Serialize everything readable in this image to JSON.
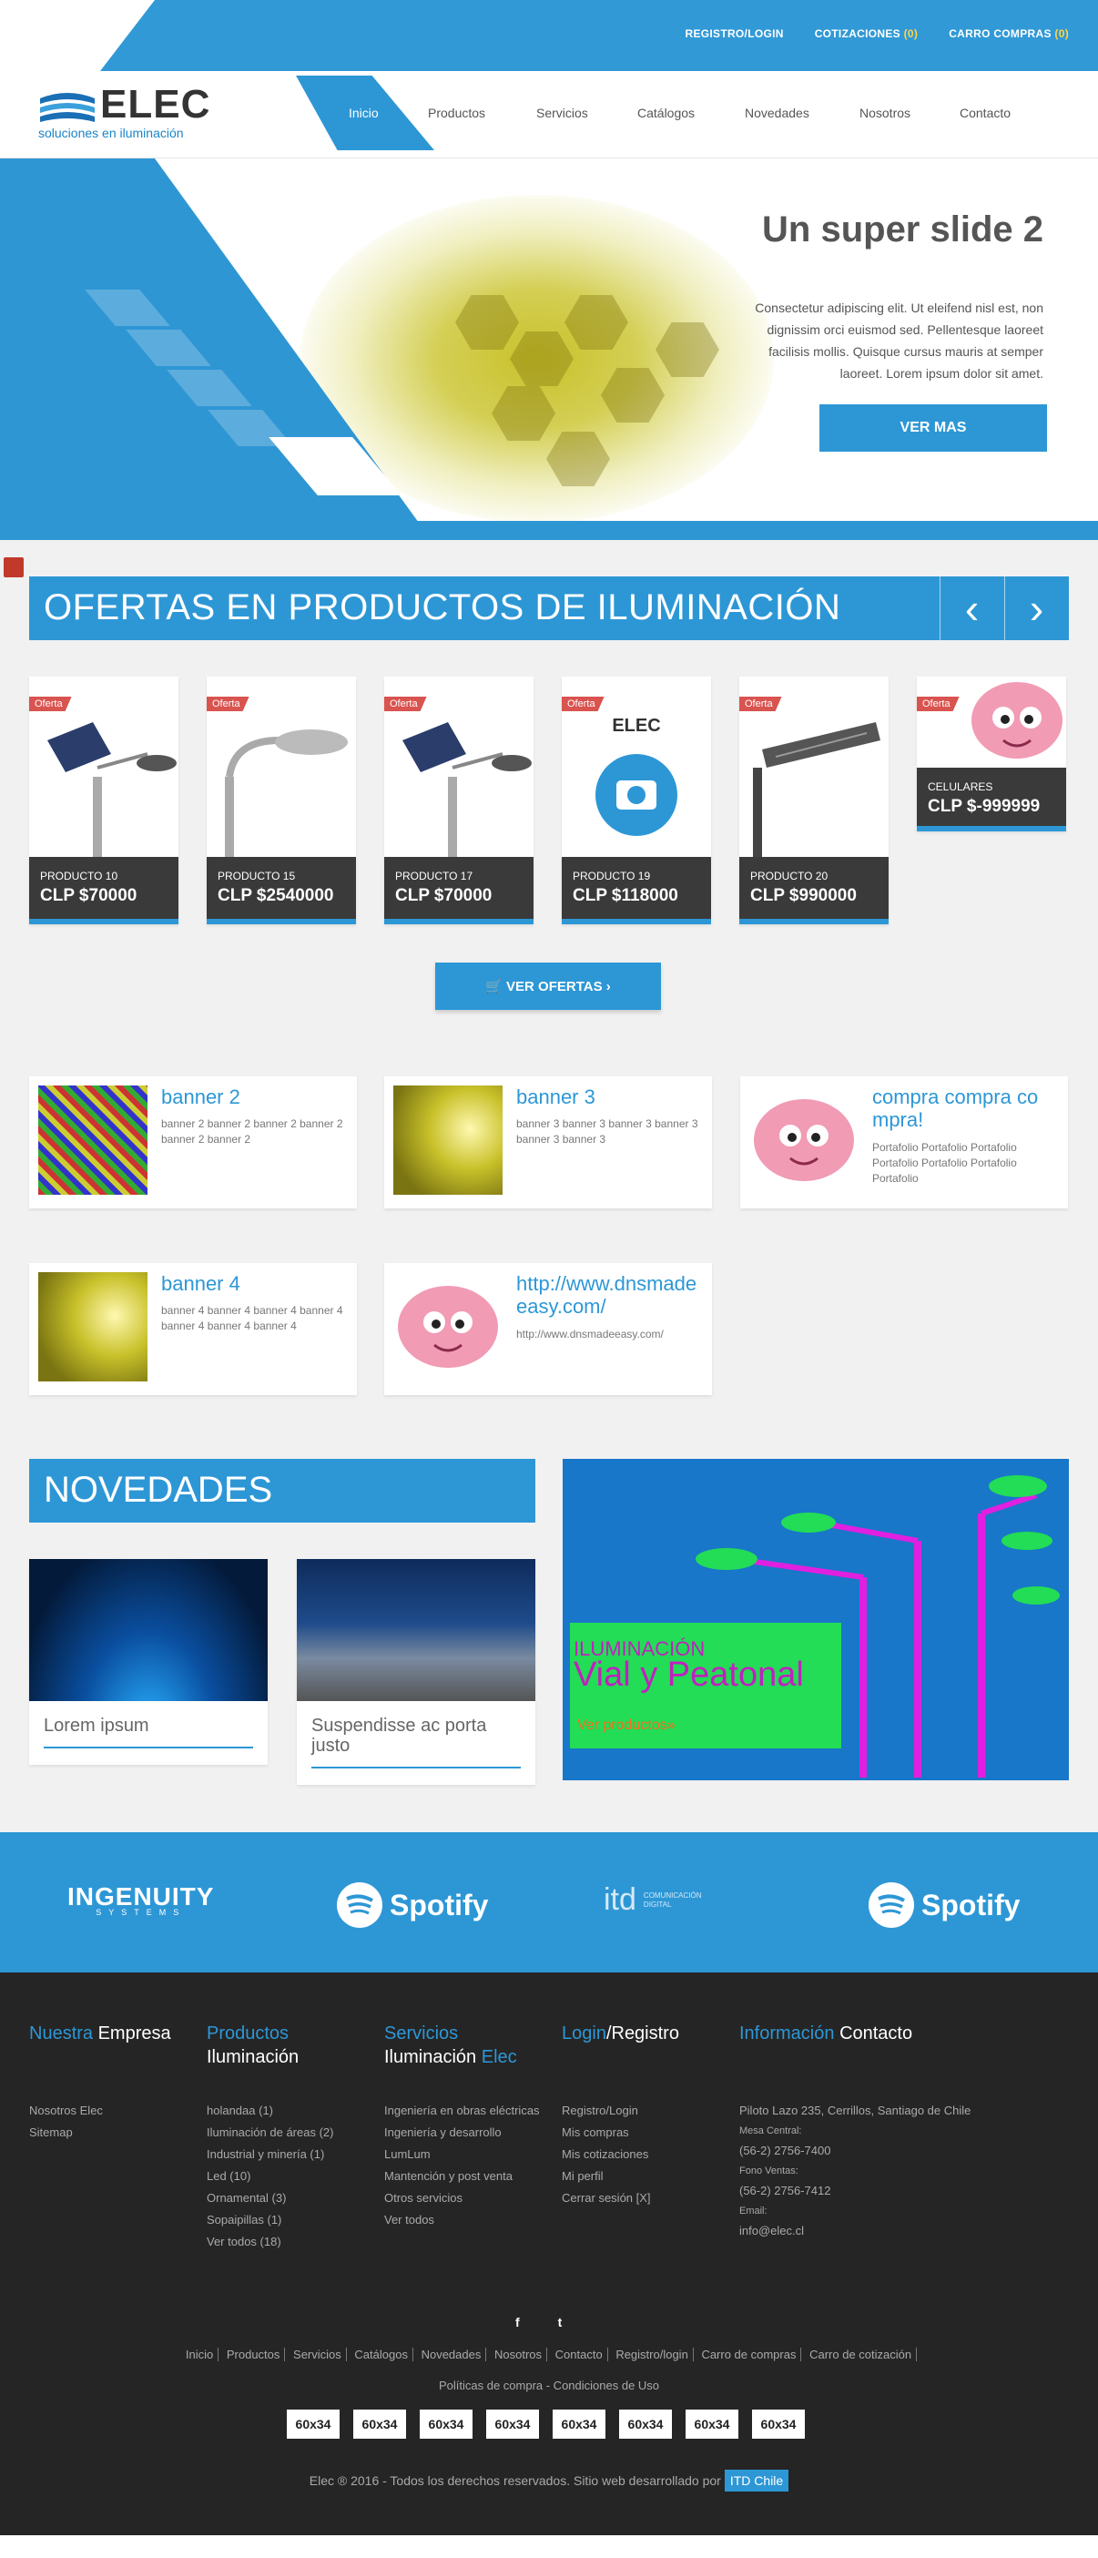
{
  "header": {
    "top_links": [
      "REGISTRO/LOGIN",
      "COTIZACIONES",
      "CARRO COMPRAS"
    ],
    "quote_count": "(0)",
    "cart_count": "(0)",
    "logo_text": "ELEC",
    "logo_tagline": "soluciones en iluminación",
    "nav": [
      "Inicio",
      "Productos",
      "Servicios",
      "Catálogos",
      "Novedades",
      "Nosotros",
      "Contacto"
    ]
  },
  "hero": {
    "title": "Un super slide 2",
    "text": "Consectetur adipiscing elit. Ut eleifend nisl est, non dignissim orci euismod sed. Pellentesque laoreet facilisis mollis. Quisque cursus mauris at semper laoreet. Lorem ipsum dolor sit amet.",
    "button": "VER MAS"
  },
  "ofertas": {
    "title": "OFERTAS EN PRODUCTOS DE ILUMINACIÓN",
    "badge": "Oferta",
    "products": [
      {
        "name": "PRODUCTO 10",
        "price": "CLP $70000"
      },
      {
        "name": "PRODUCTO 15",
        "price": "CLP $2540000"
      },
      {
        "name": "PRODUCTO 17",
        "price": "CLP $70000"
      },
      {
        "name": "PRODUCTO 19",
        "price": "CLP $118000"
      },
      {
        "name": "PRODUCTO 20",
        "price": "CLP $990000"
      },
      {
        "name": "CELULARES",
        "price": "CLP $-999999"
      }
    ],
    "button": "VER OFERTAS"
  },
  "banners": [
    {
      "title": "banner 2",
      "desc": "banner 2 banner 2 banner 2 banner 2 banner 2 banner 2"
    },
    {
      "title": "banner 3",
      "desc": "banner 3 banner 3 banner 3 banner 3 banner 3 banner 3"
    },
    {
      "title": "compra compra co mpra!",
      "desc": "Portafolio Portafolio Portafolio Portafolio Portafolio Portafolio Portafolio"
    },
    {
      "title": "banner 4",
      "desc": "banner 4 banner 4 banner 4 banner 4 banner 4 banner 4 banner 4"
    },
    {
      "title": "http://www.dnsmadeeasy.com/",
      "desc": "http://www.dnsmadeeasy.com/"
    }
  ],
  "novedades": {
    "title": "NOVEDADES",
    "items": [
      "Lorem ipsum",
      "Suspendisse ac porta justo"
    ],
    "banner_line1": "ILUMINACIÓN",
    "banner_line2": "Vial y Peatonal",
    "banner_link": "Ver productos»"
  },
  "sponsors": [
    "INGENUITY",
    "SYSTEMS",
    "Spotify",
    "itd",
    "COMUNICACIÓN DIGITAL",
    "Spotify"
  ],
  "footer": {
    "col1_title_a": "Nuestra",
    "col1_title_b": "Empresa",
    "col1_items": [
      "Nosotros Elec",
      "Sitemap"
    ],
    "col2_title_a": "Productos",
    "col2_title_b": "Iluminación",
    "col2_items": [
      "holandaa (1)",
      "Iluminación de áreas (2)",
      "Industrial y minería (1)",
      "Led (10)",
      "Ornamental (3)",
      "Sopaipillas (1)",
      "Ver todos (18)"
    ],
    "col3_title_a": "Servicios",
    "col3_title_b": "Iluminación",
    "col3_title_c": "Elec",
    "col3_items": [
      "Ingeniería en obras eléctricas",
      "Ingeniería y desarrollo",
      "LumLum",
      "Mantención y post venta",
      "Otros servicios",
      "Ver todos"
    ],
    "col4_title_a": "Login",
    "col4_title_b": "/Registro",
    "col4_items": [
      "Registro/Login",
      "Mis compras",
      "Mis cotizaciones",
      "Mi perfil",
      "Cerrar sesión [X]"
    ],
    "col5_title_a": "Información",
    "col5_title_b": "Contacto",
    "address": "Piloto Lazo 235, Cerrillos, Santiago de Chile",
    "mesa_label": "Mesa Central:",
    "mesa": "(56-2) 2756-7400",
    "ventas_label": "Fono Ventas:",
    "ventas": "(56-2) 2756-7412",
    "email_label": "Email:",
    "email": "info@elec.cl",
    "social": [
      "f",
      "t"
    ],
    "links": [
      "Inicio",
      "Productos",
      "Servicios",
      "Catálogos",
      "Novedades",
      "Nosotros",
      "Contacto",
      "Registro/login",
      "Carro de compras",
      "Carro de cotización"
    ],
    "policies": "Políticas de compra -  Condiciones de Uso",
    "ads": [
      "60x34",
      "60x34",
      "60x34",
      "60x34",
      "60x34",
      "60x34",
      "60x34",
      "60x34"
    ],
    "copyright": "Elec ® 2016 - Todos los derechos reservados. Sitio web desarrollado por",
    "itd": "ITD Chile"
  },
  "colors": {
    "primary": "#2d97d6",
    "dark": "#252525",
    "badge": "#d9534f"
  }
}
